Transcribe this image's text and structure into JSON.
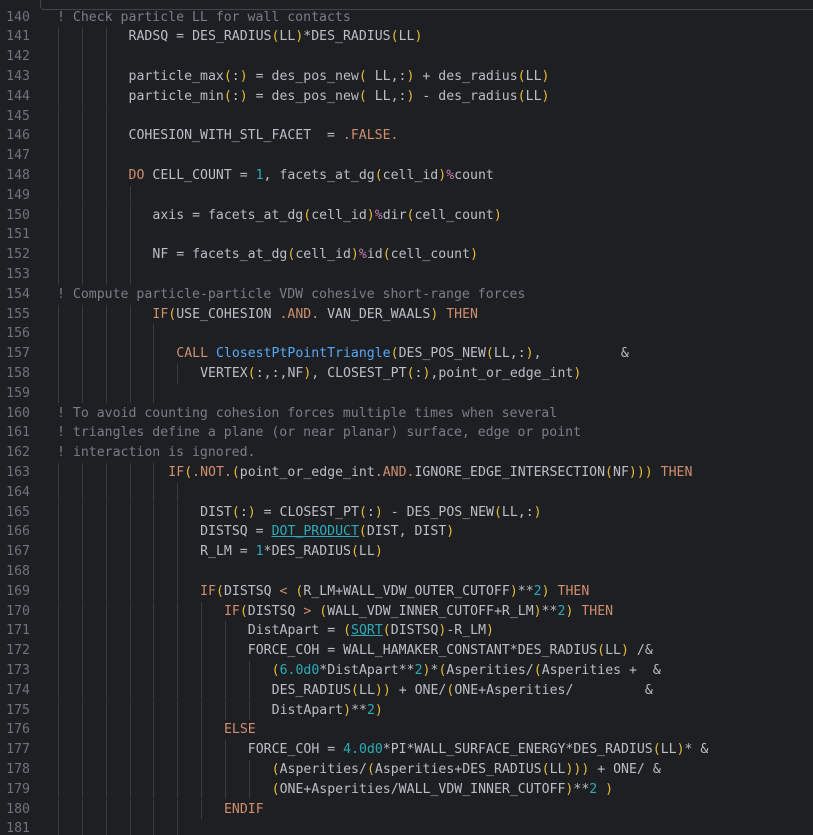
{
  "colors": {
    "background": "#1e1f22",
    "line_number": "#6f737a",
    "identifier": "#bcbec4",
    "keyword": "#cf8e6d",
    "number": "#2aacb8",
    "percent_operator": "#c77dbb",
    "function_call": "#56a8f5",
    "comment": "#7a7e85",
    "paren": "#e8ba36"
  },
  "lines": [
    {
      "n": "140",
      "indent": 0,
      "tokens": [
        {
          "t": "! Check particle LL for wall contacts",
          "k": "comment"
        }
      ]
    },
    {
      "n": "141",
      "indent": 9,
      "tokens": [
        {
          "t": "RADSQ = DES_RADIUS",
          "k": "ident"
        },
        {
          "t": "(",
          "k": "paren"
        },
        {
          "t": "LL",
          "k": "ident"
        },
        {
          "t": ")",
          "k": "paren"
        },
        {
          "t": "*DES_RADIUS",
          "k": "ident"
        },
        {
          "t": "(",
          "k": "paren"
        },
        {
          "t": "LL",
          "k": "ident"
        },
        {
          "t": ")",
          "k": "paren"
        }
      ]
    },
    {
      "n": "142",
      "indent": 9,
      "tokens": []
    },
    {
      "n": "143",
      "indent": 9,
      "tokens": [
        {
          "t": "particle_max",
          "k": "ident"
        },
        {
          "t": "(",
          "k": "paren"
        },
        {
          "t": ":",
          "k": "ident"
        },
        {
          "t": ")",
          "k": "paren"
        },
        {
          "t": " = des_pos_new",
          "k": "ident"
        },
        {
          "t": "(",
          "k": "paren"
        },
        {
          "t": " LL,:",
          "k": "ident"
        },
        {
          "t": ")",
          "k": "paren"
        },
        {
          "t": " + des_radius",
          "k": "ident"
        },
        {
          "t": "(",
          "k": "paren"
        },
        {
          "t": "LL",
          "k": "ident"
        },
        {
          "t": ")",
          "k": "paren"
        }
      ]
    },
    {
      "n": "144",
      "indent": 9,
      "tokens": [
        {
          "t": "particle_min",
          "k": "ident"
        },
        {
          "t": "(",
          "k": "paren"
        },
        {
          "t": ":",
          "k": "ident"
        },
        {
          "t": ")",
          "k": "paren"
        },
        {
          "t": " = des_pos_new",
          "k": "ident"
        },
        {
          "t": "(",
          "k": "paren"
        },
        {
          "t": " LL,:",
          "k": "ident"
        },
        {
          "t": ")",
          "k": "paren"
        },
        {
          "t": " - des_radius",
          "k": "ident"
        },
        {
          "t": "(",
          "k": "paren"
        },
        {
          "t": "LL",
          "k": "ident"
        },
        {
          "t": ")",
          "k": "paren"
        }
      ]
    },
    {
      "n": "145",
      "indent": 9,
      "tokens": []
    },
    {
      "n": "146",
      "indent": 9,
      "tokens": [
        {
          "t": "COHESION_WITH_STL_FACET  = ",
          "k": "ident"
        },
        {
          "t": ".FALSE.",
          "k": "kw"
        }
      ]
    },
    {
      "n": "147",
      "indent": 9,
      "tokens": []
    },
    {
      "n": "148",
      "indent": 9,
      "tokens": [
        {
          "t": "DO",
          "k": "kw"
        },
        {
          "t": " CELL_COUNT = ",
          "k": "ident"
        },
        {
          "t": "1",
          "k": "num"
        },
        {
          "t": ", facets_at_dg",
          "k": "ident"
        },
        {
          "t": "(",
          "k": "paren"
        },
        {
          "t": "cell_id",
          "k": "ident"
        },
        {
          "t": ")",
          "k": "paren"
        },
        {
          "t": "%",
          "k": "pct"
        },
        {
          "t": "count",
          "k": "ident"
        }
      ]
    },
    {
      "n": "149",
      "indent": 12,
      "tokens": []
    },
    {
      "n": "150",
      "indent": 12,
      "tokens": [
        {
          "t": "axis = facets_at_dg",
          "k": "ident"
        },
        {
          "t": "(",
          "k": "paren"
        },
        {
          "t": "cell_id",
          "k": "ident"
        },
        {
          "t": ")",
          "k": "paren"
        },
        {
          "t": "%",
          "k": "pct"
        },
        {
          "t": "dir",
          "k": "ident"
        },
        {
          "t": "(",
          "k": "paren"
        },
        {
          "t": "cell_count",
          "k": "ident"
        },
        {
          "t": ")",
          "k": "paren"
        }
      ]
    },
    {
      "n": "151",
      "indent": 12,
      "tokens": []
    },
    {
      "n": "152",
      "indent": 12,
      "tokens": [
        {
          "t": "NF = facets_at_dg",
          "k": "ident"
        },
        {
          "t": "(",
          "k": "paren"
        },
        {
          "t": "cell_id",
          "k": "ident"
        },
        {
          "t": ")",
          "k": "paren"
        },
        {
          "t": "%",
          "k": "pct"
        },
        {
          "t": "id",
          "k": "ident"
        },
        {
          "t": "(",
          "k": "paren"
        },
        {
          "t": "cell_count",
          "k": "ident"
        },
        {
          "t": ")",
          "k": "paren"
        }
      ]
    },
    {
      "n": "153",
      "indent": 12,
      "tokens": []
    },
    {
      "n": "154",
      "indent": 0,
      "tokens": [
        {
          "t": "! Compute particle-particle VDW cohesive short-range forces",
          "k": "comment"
        }
      ]
    },
    {
      "n": "155",
      "indent": 12,
      "tokens": [
        {
          "t": "IF",
          "k": "kw"
        },
        {
          "t": "(",
          "k": "paren"
        },
        {
          "t": "USE_COHESION ",
          "k": "ident"
        },
        {
          "t": ".AND.",
          "k": "kw"
        },
        {
          "t": " VAN_DER_WAALS",
          "k": "ident"
        },
        {
          "t": ")",
          "k": "paren"
        },
        {
          "t": " THEN",
          "k": "kw"
        }
      ]
    },
    {
      "n": "156",
      "indent": 15,
      "tokens": []
    },
    {
      "n": "157",
      "indent": 15,
      "tokens": [
        {
          "t": "CALL ",
          "k": "kw"
        },
        {
          "t": "ClosestPtPointTriangle",
          "k": "fn"
        },
        {
          "t": "(",
          "k": "paren"
        },
        {
          "t": "DES_POS_NEW",
          "k": "ident"
        },
        {
          "t": "(",
          "k": "paren"
        },
        {
          "t": "LL,:",
          "k": "ident"
        },
        {
          "t": ")",
          "k": "paren"
        },
        {
          "t": ",          &",
          "k": "ident"
        }
      ]
    },
    {
      "n": "158",
      "indent": 18,
      "tokens": [
        {
          "t": "VERTEX",
          "k": "ident"
        },
        {
          "t": "(",
          "k": "paren"
        },
        {
          "t": ":,:,NF",
          "k": "ident"
        },
        {
          "t": ")",
          "k": "paren"
        },
        {
          "t": ", CLOSEST_PT",
          "k": "ident"
        },
        {
          "t": "(",
          "k": "paren"
        },
        {
          "t": ":",
          "k": "ident"
        },
        {
          "t": ")",
          "k": "paren"
        },
        {
          "t": ",point_or_edge_int",
          "k": "ident"
        },
        {
          "t": ")",
          "k": "paren"
        }
      ]
    },
    {
      "n": "159",
      "indent": 15,
      "tokens": []
    },
    {
      "n": "160",
      "indent": 0,
      "tokens": [
        {
          "t": "! To avoid counting cohesion forces multiple times when several",
          "k": "comment"
        }
      ]
    },
    {
      "n": "161",
      "indent": 0,
      "tokens": [
        {
          "t": "! triangles define a plane (or near planar) surface, edge or point",
          "k": "comment"
        }
      ]
    },
    {
      "n": "162",
      "indent": 0,
      "tokens": [
        {
          "t": "! interaction is ignored.",
          "k": "comment"
        }
      ]
    },
    {
      "n": "163",
      "indent": 14,
      "tokens": [
        {
          "t": "IF",
          "k": "kw"
        },
        {
          "t": "(",
          "k": "paren"
        },
        {
          "t": ".NOT.",
          "k": "kw"
        },
        {
          "t": "(",
          "k": "paren"
        },
        {
          "t": "point_or_edge_int",
          "k": "ident"
        },
        {
          "t": ".AND.",
          "k": "kw"
        },
        {
          "t": "IGNORE_EDGE_INTERSECTION",
          "k": "ident"
        },
        {
          "t": "(",
          "k": "paren"
        },
        {
          "t": "NF",
          "k": "ident"
        },
        {
          "t": ")))",
          "k": "paren"
        },
        {
          "t": " THEN",
          "k": "kw"
        }
      ]
    },
    {
      "n": "164",
      "indent": 18,
      "tokens": []
    },
    {
      "n": "165",
      "indent": 18,
      "tokens": [
        {
          "t": "DIST",
          "k": "ident"
        },
        {
          "t": "(",
          "k": "paren"
        },
        {
          "t": ":",
          "k": "ident"
        },
        {
          "t": ")",
          "k": "paren"
        },
        {
          "t": " = CLOSEST_PT",
          "k": "ident"
        },
        {
          "t": "(",
          "k": "paren"
        },
        {
          "t": ":",
          "k": "ident"
        },
        {
          "t": ")",
          "k": "paren"
        },
        {
          "t": " - DES_POS_NEW",
          "k": "ident"
        },
        {
          "t": "(",
          "k": "paren"
        },
        {
          "t": "LL,:",
          "k": "ident"
        },
        {
          "t": ")",
          "k": "paren"
        }
      ]
    },
    {
      "n": "166",
      "indent": 18,
      "tokens": [
        {
          "t": "DISTSQ = ",
          "k": "ident"
        },
        {
          "t": "DOT_PRODUCT",
          "k": "builtin"
        },
        {
          "t": "(",
          "k": "paren"
        },
        {
          "t": "DIST, DIST",
          "k": "ident"
        },
        {
          "t": ")",
          "k": "paren"
        }
      ]
    },
    {
      "n": "167",
      "indent": 18,
      "tokens": [
        {
          "t": "R_LM = ",
          "k": "ident"
        },
        {
          "t": "1",
          "k": "num"
        },
        {
          "t": "*DES_RADIUS",
          "k": "ident"
        },
        {
          "t": "(",
          "k": "paren"
        },
        {
          "t": "LL",
          "k": "ident"
        },
        {
          "t": ")",
          "k": "paren"
        }
      ]
    },
    {
      "n": "168",
      "indent": 18,
      "tokens": []
    },
    {
      "n": "169",
      "indent": 18,
      "tokens": [
        {
          "t": "IF",
          "k": "kw"
        },
        {
          "t": "(",
          "k": "paren"
        },
        {
          "t": "DISTSQ ",
          "k": "ident"
        },
        {
          "t": "<",
          "k": "kw"
        },
        {
          "t": " ",
          "k": "ident"
        },
        {
          "t": "(",
          "k": "paren"
        },
        {
          "t": "R_LM+WALL_VDW_OUTER_CUTOFF",
          "k": "ident"
        },
        {
          "t": ")",
          "k": "paren"
        },
        {
          "t": "**",
          "k": "ident"
        },
        {
          "t": "2",
          "k": "num"
        },
        {
          "t": ")",
          "k": "paren"
        },
        {
          "t": " THEN",
          "k": "kw"
        }
      ]
    },
    {
      "n": "170",
      "indent": 21,
      "tokens": [
        {
          "t": "IF",
          "k": "kw"
        },
        {
          "t": "(",
          "k": "paren"
        },
        {
          "t": "DISTSQ ",
          "k": "ident"
        },
        {
          "t": ">",
          "k": "kw"
        },
        {
          "t": " ",
          "k": "ident"
        },
        {
          "t": "(",
          "k": "paren"
        },
        {
          "t": "WALL_VDW_INNER_CUTOFF+R_LM",
          "k": "ident"
        },
        {
          "t": ")",
          "k": "paren"
        },
        {
          "t": "**",
          "k": "ident"
        },
        {
          "t": "2",
          "k": "num"
        },
        {
          "t": ")",
          "k": "paren"
        },
        {
          "t": " THEN",
          "k": "kw"
        }
      ]
    },
    {
      "n": "171",
      "indent": 24,
      "tokens": [
        {
          "t": "DistApart = ",
          "k": "ident"
        },
        {
          "t": "(",
          "k": "paren"
        },
        {
          "t": "SQRT",
          "k": "builtin"
        },
        {
          "t": "(",
          "k": "paren"
        },
        {
          "t": "DISTSQ",
          "k": "ident"
        },
        {
          "t": ")",
          "k": "paren"
        },
        {
          "t": "-R_LM",
          "k": "ident"
        },
        {
          "t": ")",
          "k": "paren"
        }
      ]
    },
    {
      "n": "172",
      "indent": 24,
      "tokens": [
        {
          "t": "FORCE_COH = WALL_HAMAKER_CONSTANT*DES_RADIUS",
          "k": "ident"
        },
        {
          "t": "(",
          "k": "paren"
        },
        {
          "t": "LL",
          "k": "ident"
        },
        {
          "t": ")",
          "k": "paren"
        },
        {
          "t": " /&",
          "k": "ident"
        }
      ]
    },
    {
      "n": "173",
      "indent": 27,
      "tokens": [
        {
          "t": "(",
          "k": "paren"
        },
        {
          "t": "6.0d0",
          "k": "num"
        },
        {
          "t": "*DistApart**",
          "k": "ident"
        },
        {
          "t": "2",
          "k": "num"
        },
        {
          "t": ")",
          "k": "paren"
        },
        {
          "t": "*",
          "k": "ident"
        },
        {
          "t": "(",
          "k": "paren"
        },
        {
          "t": "Asperities/",
          "k": "ident"
        },
        {
          "t": "(",
          "k": "paren"
        },
        {
          "t": "Asperities +  &",
          "k": "ident"
        }
      ]
    },
    {
      "n": "174",
      "indent": 27,
      "tokens": [
        {
          "t": "DES_RADIUS",
          "k": "ident"
        },
        {
          "t": "(",
          "k": "paren"
        },
        {
          "t": "LL",
          "k": "ident"
        },
        {
          "t": "))",
          "k": "paren"
        },
        {
          "t": " + ONE/",
          "k": "ident"
        },
        {
          "t": "(",
          "k": "paren"
        },
        {
          "t": "ONE+Asperities/         &",
          "k": "ident"
        }
      ]
    },
    {
      "n": "175",
      "indent": 27,
      "tokens": [
        {
          "t": "DistApart",
          "k": "ident"
        },
        {
          "t": ")",
          "k": "paren"
        },
        {
          "t": "**",
          "k": "ident"
        },
        {
          "t": "2",
          "k": "num"
        },
        {
          "t": ")",
          "k": "paren"
        }
      ]
    },
    {
      "n": "176",
      "indent": 21,
      "tokens": [
        {
          "t": "ELSE",
          "k": "kw"
        }
      ]
    },
    {
      "n": "177",
      "indent": 24,
      "tokens": [
        {
          "t": "FORCE_COH = ",
          "k": "ident"
        },
        {
          "t": "4.0d0",
          "k": "num"
        },
        {
          "t": "*PI*WALL_SURFACE_ENERGY*DES_RADIUS",
          "k": "ident"
        },
        {
          "t": "(",
          "k": "paren"
        },
        {
          "t": "LL",
          "k": "ident"
        },
        {
          "t": ")",
          "k": "paren"
        },
        {
          "t": "* &",
          "k": "ident"
        }
      ]
    },
    {
      "n": "178",
      "indent": 27,
      "tokens": [
        {
          "t": "(",
          "k": "paren"
        },
        {
          "t": "Asperities/",
          "k": "ident"
        },
        {
          "t": "(",
          "k": "paren"
        },
        {
          "t": "Asperities+DES_RADIUS",
          "k": "ident"
        },
        {
          "t": "(",
          "k": "paren"
        },
        {
          "t": "LL",
          "k": "ident"
        },
        {
          "t": ")))",
          "k": "paren"
        },
        {
          "t": " + ONE/ &",
          "k": "ident"
        }
      ]
    },
    {
      "n": "179",
      "indent": 27,
      "tokens": [
        {
          "t": "(",
          "k": "paren"
        },
        {
          "t": "ONE+Asperities/WALL_VDW_INNER_CUTOFF",
          "k": "ident"
        },
        {
          "t": ")",
          "k": "paren"
        },
        {
          "t": "**",
          "k": "ident"
        },
        {
          "t": "2",
          "k": "num"
        },
        {
          "t": " )",
          "k": "paren"
        }
      ]
    },
    {
      "n": "180",
      "indent": 21,
      "tokens": [
        {
          "t": "ENDIF",
          "k": "kw"
        }
      ]
    },
    {
      "n": "181",
      "indent": 18,
      "tokens": []
    }
  ]
}
